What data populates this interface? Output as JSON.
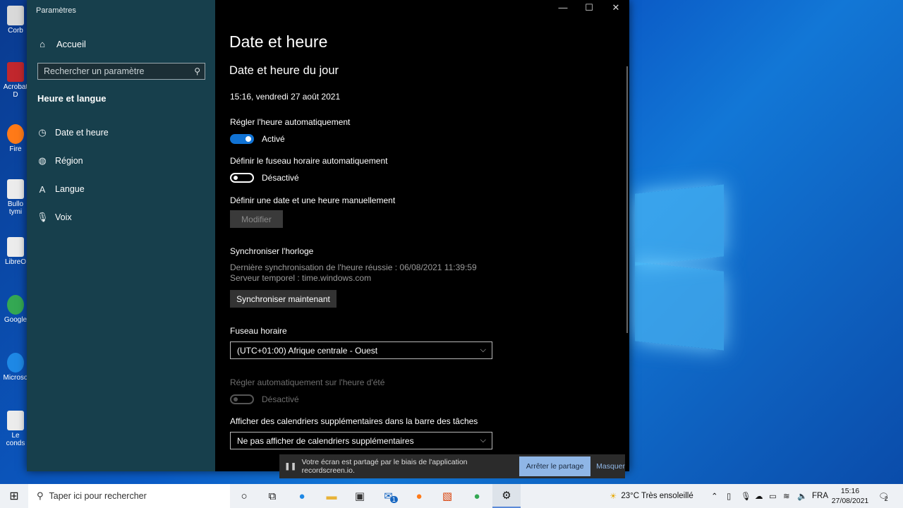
{
  "desktop": {
    "icons": [
      {
        "label": "Corb",
        "color": "#d9d9d9"
      },
      {
        "label": "Acrobat D",
        "color": "#c1272d"
      },
      {
        "label": "Fire",
        "color": "#ff7a18"
      },
      {
        "label": "Bullo tymi",
        "color": "#ececec"
      },
      {
        "label": "LibreO",
        "color": "#ececec"
      },
      {
        "label": "Google",
        "color": "#34a853"
      },
      {
        "label": "Microso",
        "color": "#1e88e5"
      },
      {
        "label": "Le conds",
        "color": "#ececec"
      }
    ]
  },
  "window": {
    "title": "Paramètres",
    "controls": [
      "—",
      "☐",
      "✕"
    ]
  },
  "sidebar": {
    "home_label": "Accueil",
    "search_placeholder": "Rechercher un paramètre",
    "section_title": "Heure et langue",
    "items": [
      {
        "label": "Date et heure",
        "icon": "calendar-clock-icon"
      },
      {
        "label": "Région",
        "icon": "globe-icon"
      },
      {
        "label": "Langue",
        "icon": "language-icon"
      },
      {
        "label": "Voix",
        "icon": "microphone-icon"
      }
    ]
  },
  "content": {
    "page_title": "Date et heure",
    "subtitle": "Date et heure du jour",
    "current_datetime": "15:16, vendredi 27 août 2021",
    "auto_time": {
      "label": "Régler l'heure automatiquement",
      "state": "Activé"
    },
    "auto_timezone": {
      "label": "Définir le fuseau horaire automatiquement",
      "state": "Désactivé"
    },
    "manual": {
      "label": "Définir une date et une heure manuellement",
      "button": "Modifier"
    },
    "sync": {
      "title": "Synchroniser l'horloge",
      "last_sync": "Dernière synchronisation de l'heure réussie : 06/08/2021 11:39:59",
      "server": "Serveur temporel : time.windows.com",
      "button": "Synchroniser maintenant"
    },
    "timezone": {
      "label": "Fuseau horaire",
      "value": "(UTC+01:00) Afrique centrale - Ouest"
    },
    "dst": {
      "label": "Régler automatiquement sur l'heure d'été",
      "state": "Désactivé"
    },
    "calendars": {
      "label": "Afficher des calendriers supplémentaires dans la barre des tâches",
      "value": "Ne pas afficher de calendriers supplémentaires"
    }
  },
  "share_bar": {
    "message": "Votre écran est partagé par le biais de l'application recordscreen.io.",
    "stop_label": "Arrêter le partage",
    "hide_label": "Masquer"
  },
  "taskbar": {
    "search_placeholder": "Taper ici pour rechercher",
    "mail_badge": "1",
    "weather": "23°C  Très ensoleillé",
    "lang": "FRA",
    "time": "15:16",
    "date": "27/08/2021",
    "notif_count": "2"
  }
}
